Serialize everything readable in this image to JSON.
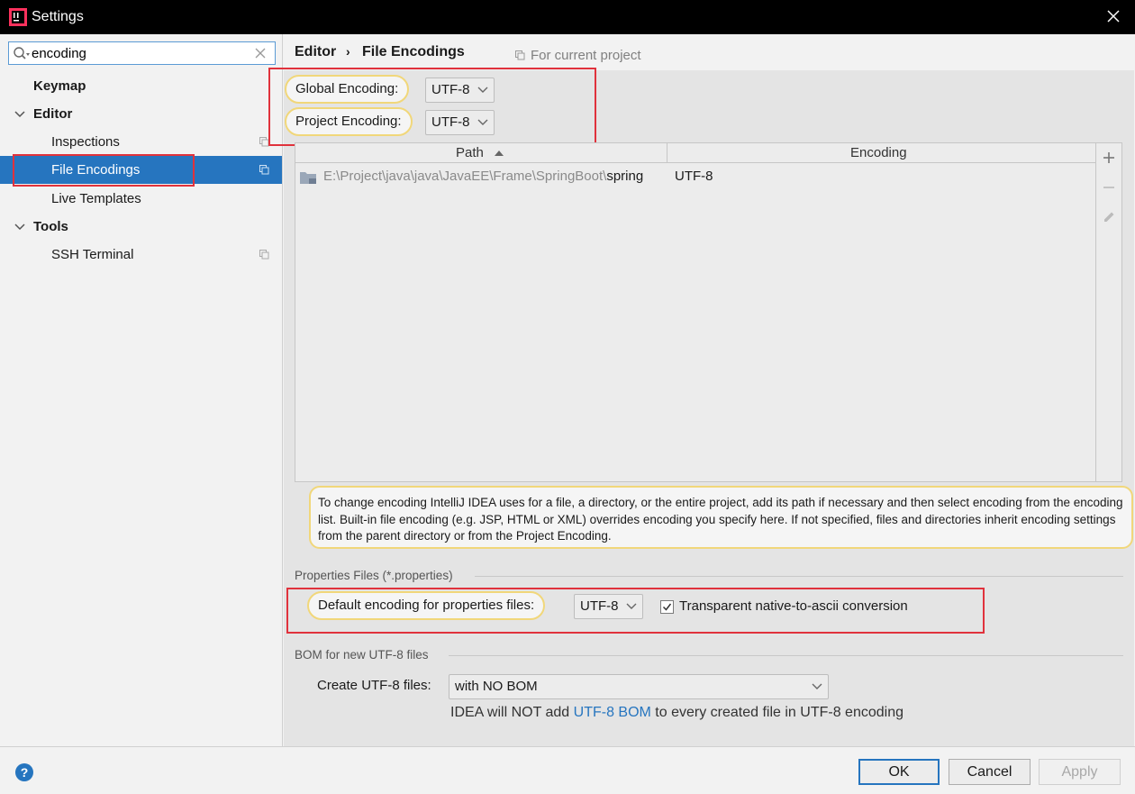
{
  "window": {
    "title": "Settings"
  },
  "sidebar": {
    "search": {
      "value": "encoding"
    },
    "items": [
      {
        "label": "Keymap"
      },
      {
        "label": "Editor"
      },
      {
        "label": "Inspections"
      },
      {
        "label": "File Encodings"
      },
      {
        "label": "Live Templates"
      },
      {
        "label": "Tools"
      },
      {
        "label": "SSH Terminal"
      }
    ]
  },
  "breadcrumb": {
    "parent": "Editor",
    "separator": "›",
    "current": "File Encodings",
    "scope": "For current project"
  },
  "encodings": {
    "global_label": "Global Encoding:",
    "global_value": "UTF-8",
    "project_label": "Project Encoding:",
    "project_value": "UTF-8"
  },
  "table": {
    "columns": [
      "Path",
      "Encoding"
    ],
    "rows": [
      {
        "path_prefix": "E:\\Project\\java\\java\\JavaEE\\Frame\\SpringBoot\\",
        "path_last": "spring",
        "encoding": "UTF-8"
      }
    ]
  },
  "note": "To change encoding IntelliJ IDEA uses for a file, a directory, or the entire project, add its path if necessary and then select encoding from the encoding list. Built-in file encoding (e.g. JSP, HTML or XML) overrides encoding you specify here. If not specified, files and directories inherit encoding settings from the parent directory or from the Project Encoding.",
  "properties": {
    "section_title": "Properties Files (*.properties)",
    "default_label": "Default encoding for properties files:",
    "default_value": "UTF-8",
    "transparent_label": "Transparent native-to-ascii conversion",
    "transparent_checked": true
  },
  "bom": {
    "section_title": "BOM for new UTF-8 files",
    "create_label": "Create UTF-8 files:",
    "create_value": "with NO BOM",
    "hint_before": "IDEA will NOT add ",
    "hint_link": "UTF-8 BOM",
    "hint_after": " to every created file in UTF-8 encoding"
  },
  "buttons": {
    "ok": "OK",
    "cancel": "Cancel",
    "apply": "Apply"
  },
  "colors": {
    "accent": "#2675bf",
    "highlight_box": "#e0323c",
    "callout_border": "#f1d77a"
  }
}
